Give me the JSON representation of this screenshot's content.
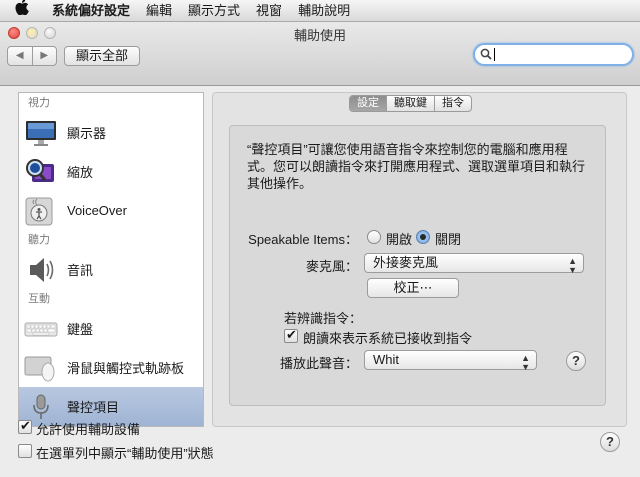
{
  "menubar": {
    "apple_icon": "apple-icon",
    "app_name": "系統偏好設定",
    "items": [
      "編輯",
      "顯示方式",
      "視窗",
      "輔助說明"
    ]
  },
  "window": {
    "title": "輔助使用",
    "show_all_label": "顯示全部",
    "back_glyph": "◀",
    "forward_glyph": "▶",
    "search": {
      "value": "",
      "placeholder": ""
    }
  },
  "sidebar": {
    "sections": [
      {
        "header": "視力",
        "items": [
          {
            "label": "顯示器",
            "icon": "display-icon"
          },
          {
            "label": "縮放",
            "icon": "zoom-icon"
          },
          {
            "label": "VoiceOver",
            "icon": "voiceover-icon"
          }
        ]
      },
      {
        "header": "聽力",
        "items": [
          {
            "label": "音訊",
            "icon": "speaker-icon"
          }
        ]
      },
      {
        "header": "互動",
        "items": [
          {
            "label": "鍵盤",
            "icon": "keyboard-icon"
          },
          {
            "label": "滑鼠與觸控式軌跡板",
            "icon": "mouse-icon"
          },
          {
            "label": "聲控項目",
            "icon": "microphone-icon",
            "selected": true
          }
        ]
      }
    ]
  },
  "tabs": [
    {
      "label": "設定",
      "active": true
    },
    {
      "label": "聽取鍵",
      "active": false
    },
    {
      "label": "指令",
      "active": false
    }
  ],
  "panel": {
    "description": "“聲控項目”可讓您使用語音指令來控制您的電腦和應用程式。您可以朗讀指令來打開應用程式、選取選單項目和執行其他操作。",
    "speakable_label": "Speakable Items：",
    "radio_on": "開啟",
    "radio_off": "關閉",
    "speakable_selected": "關閉",
    "mic_label": "麥克風：",
    "mic_value": "外接麥克風",
    "calibrate_label": "校正⋯",
    "if_recognized_label": "若辨識指令：",
    "speak_ack_label": "朗讀來表示系統已接收到指令",
    "speak_ack_checked": true,
    "play_sound_label": "播放此聲音：",
    "play_sound_value": "Whit",
    "help_glyph": "?"
  },
  "footer": {
    "allow_assistive_label": "允許使用輔助設備",
    "allow_assistive_checked": true,
    "show_in_menu_label": "在選單列中顯示“輔助使用”狀態",
    "show_in_menu_checked": false,
    "help_glyph": "?"
  },
  "colors": {
    "selection": "#a9bcd9",
    "focus_ring": "#7fb0e6"
  }
}
